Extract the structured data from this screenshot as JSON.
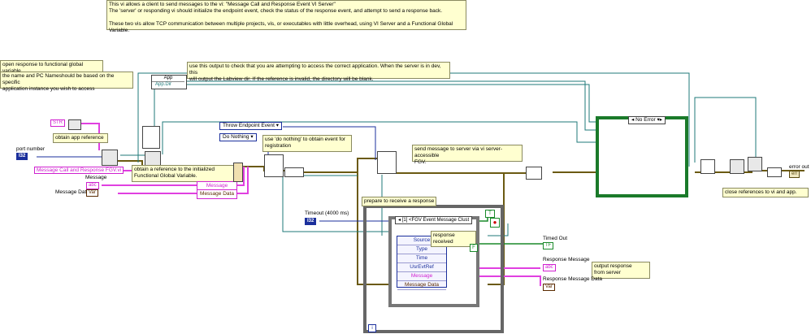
{
  "comments": {
    "header": "This vi allows a client to send messages to the vi: \"Message Call and Response Event VI Server\"\nThe 'server' or responding vi should initialize the endpoint event, check the status of the response event, and attempt to send a response back.\n\nThese two vis allow TCP communication between multiple projects, vis, or executables with little overhead, using VI Server and a Functional Global Variable.",
    "open_response": "open response to functional global variable",
    "nameshould": "the name and PC Nameshould be based on the specific\napplication instance you wish to access",
    "output_check": "use this output to check that you are attempting to access the correct application. When the server is in dev, this\nwill output the Labview dir. If the reference is invalid, the directory will be blank.",
    "obtain_app_ref": "obtain app reference",
    "obtain_fgv_ref": "obtain a reference to the initialized\nFunctional Global Variable.",
    "do_nothing_note": "use 'do nothing' to obtain event for\nregistration",
    "send_message": "send message to server via vi server-accessible\nFGV.",
    "prepare_response": "prepare to receive a response",
    "response_received": "response received",
    "output_response": "output response\nfrom server",
    "close_refs": "close references to vi and app."
  },
  "labels": {
    "port_number": "port number",
    "message": "Message",
    "message_data": "Message Data",
    "timeout": "Timeout (4000 ms)",
    "timed_out": "Timed Out",
    "response_message": "Response Message",
    "response_message_data": "Response Message Data",
    "error_out": "error out"
  },
  "constants": {
    "fgv_path": "Message Call and Response FGV.vi",
    "throw_endpoint": "Throw Endpoint Event",
    "do_nothing": "Do Nothing",
    "case_selector": "No Error",
    "event_case": "[1] <FGV Event Message Clust",
    "app_property": "App",
    "app_dir": "App.Dir",
    "true_const": "T",
    "false_const": "F",
    "loop_i": "i",
    "bundle_message": "Message",
    "bundle_message_data": "Message Data"
  },
  "terminals": {
    "port_type": "I32",
    "message_type": "abc",
    "message_data_type": "Var",
    "timeout_type": "I32",
    "timed_out_type": "TF",
    "response_message_type": "abc",
    "response_data_type": "Var",
    "error_out_type": "err",
    "str_const": "STR"
  },
  "event_data": {
    "fields": [
      "Source",
      "Type",
      "Time",
      "UsrEvtRef",
      "Message",
      "Message Data"
    ]
  },
  "colors": {
    "wire_ref": "#1f7a7a",
    "wire_string": "#e040e0",
    "wire_error": "#5a4a10",
    "wire_enum": "#1b2f9c",
    "structure_frame": "#555555",
    "case_frame": "#1a7a2a",
    "comment_bg": "#ffffd0"
  }
}
